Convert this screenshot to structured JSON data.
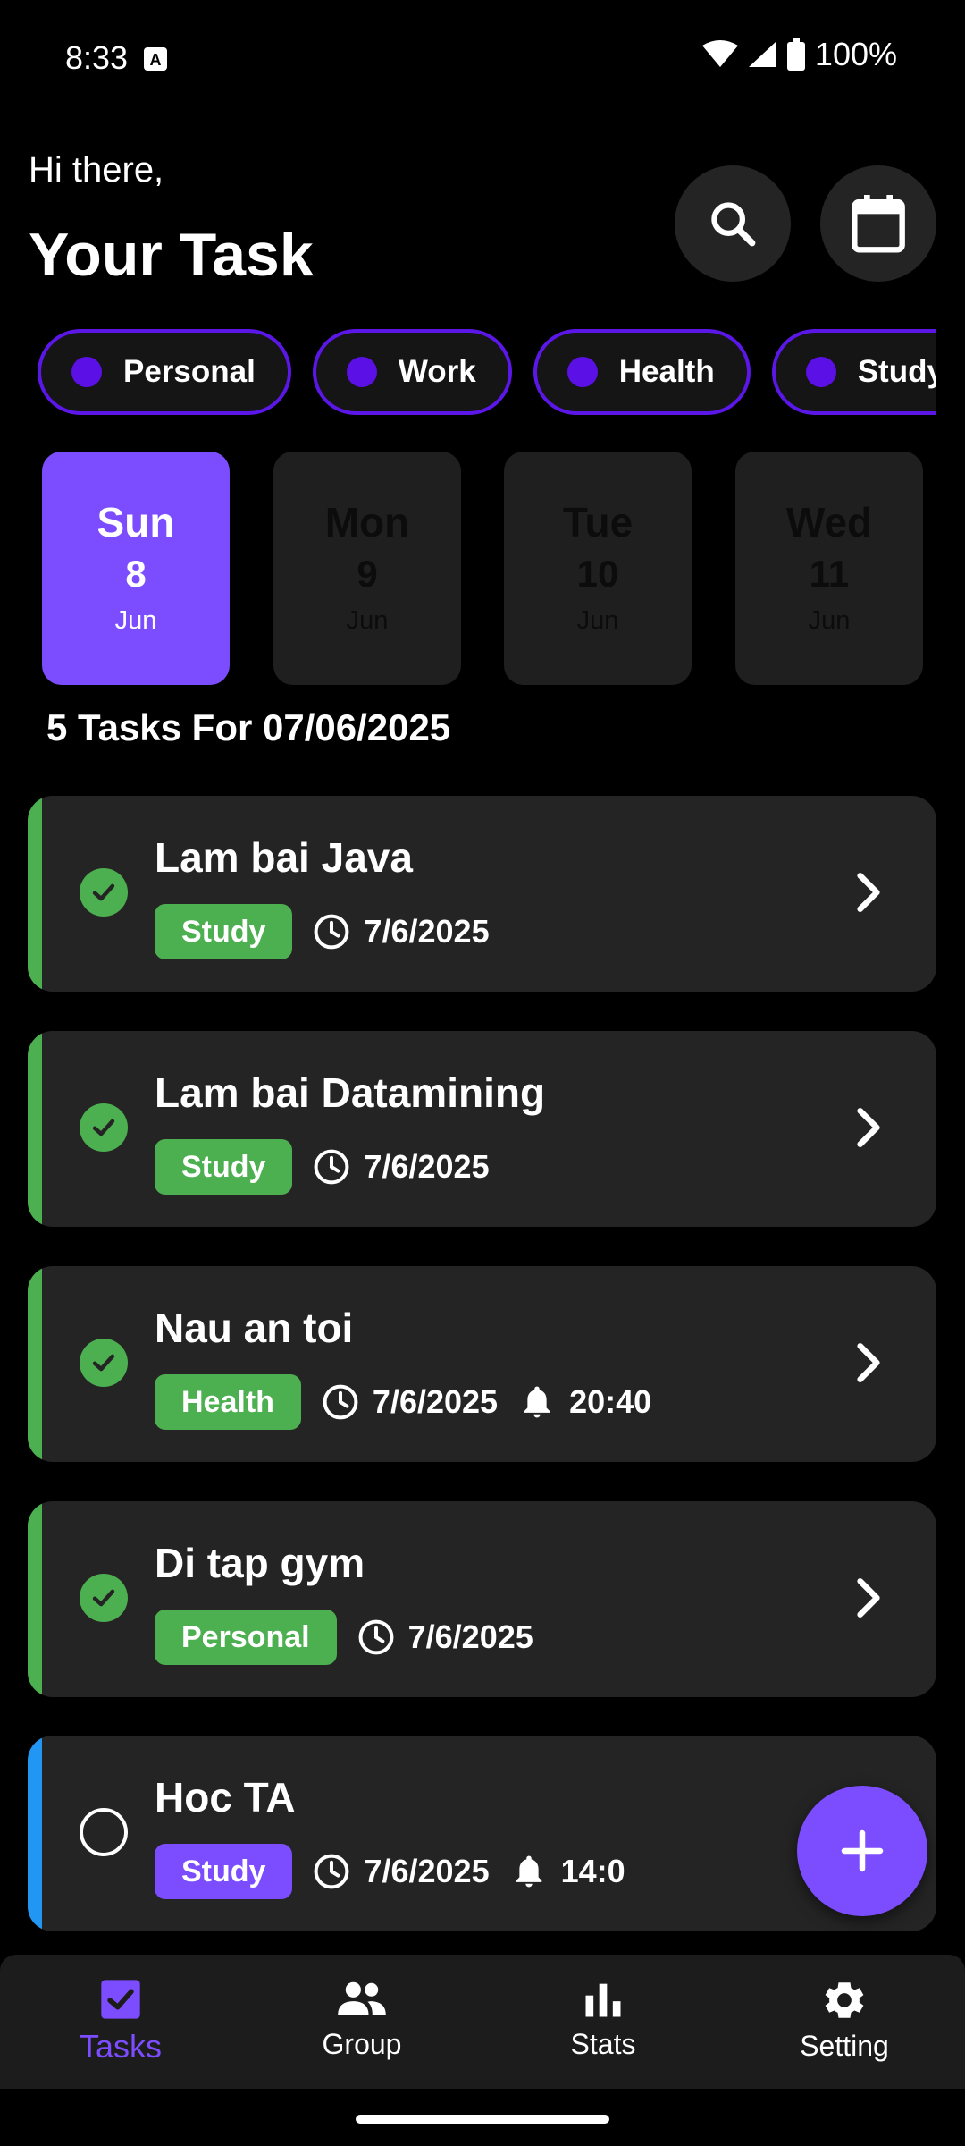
{
  "status_bar": {
    "time": "8:33",
    "battery": "100%"
  },
  "header": {
    "greeting": "Hi there,",
    "title": "Your Task"
  },
  "categories": [
    {
      "label": "Personal"
    },
    {
      "label": "Work"
    },
    {
      "label": "Health"
    },
    {
      "label": "Study"
    }
  ],
  "days": [
    {
      "name": "Sun",
      "num": "8",
      "month": "Jun",
      "active": true
    },
    {
      "name": "Mon",
      "num": "9",
      "month": "Jun",
      "active": false
    },
    {
      "name": "Tue",
      "num": "10",
      "month": "Jun",
      "active": false
    },
    {
      "name": "Wed",
      "num": "11",
      "month": "Jun",
      "active": false
    }
  ],
  "tasks_heading": "5 Tasks For 07/06/2025",
  "tasks": [
    {
      "title": "Lam bai Java",
      "tag": "Study",
      "date": "7/6/2025",
      "reminder": "",
      "done": true
    },
    {
      "title": "Lam bai Datamining",
      "tag": "Study",
      "date": "7/6/2025",
      "reminder": "",
      "done": true
    },
    {
      "title": "Nau an toi",
      "tag": "Health",
      "date": "7/6/2025",
      "reminder": "20:40",
      "done": true
    },
    {
      "title": "Di tap gym",
      "tag": "Personal",
      "date": "7/6/2025",
      "reminder": "",
      "done": true
    },
    {
      "title": "Hoc TA",
      "tag": "Study",
      "date": "7/6/2025",
      "reminder": "14:0",
      "done": false
    }
  ],
  "nav": [
    {
      "label": "Tasks",
      "active": true
    },
    {
      "label": "Group",
      "active": false
    },
    {
      "label": "Stats",
      "active": false
    },
    {
      "label": "Setting",
      "active": false
    }
  ],
  "colors": {
    "accent": "#7c4dff",
    "chip_border": "#5b16e8",
    "done_green": "#4caf50",
    "pending_blue": "#2196f3",
    "card_bg": "#242424"
  }
}
